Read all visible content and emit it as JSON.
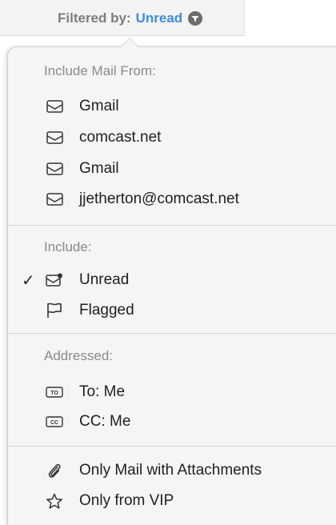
{
  "toolbar": {
    "filter_label": "Filtered by:",
    "filter_value": "Unread",
    "filter_icon": "filter-circle-icon"
  },
  "menu": {
    "mail_from": {
      "header": "Include Mail From:",
      "items": [
        {
          "label": "Gmail",
          "icon": "envelope-open-icon"
        },
        {
          "label": "comcast.net",
          "icon": "envelope-open-icon"
        },
        {
          "label": "Gmail",
          "icon": "envelope-open-icon"
        },
        {
          "label": "jjetherton@comcast.net",
          "icon": "envelope-open-icon"
        }
      ]
    },
    "include": {
      "header": "Include:",
      "items": [
        {
          "label": "Unread",
          "icon": "unread-envelope-icon",
          "checked": true
        },
        {
          "label": "Flagged",
          "icon": "flag-icon",
          "checked": false
        }
      ],
      "check_mark": "✓"
    },
    "addressed": {
      "header": "Addressed:",
      "items": [
        {
          "label": "To: Me",
          "icon": "to-badge-icon",
          "badge": "TO"
        },
        {
          "label": "CC: Me",
          "icon": "cc-badge-icon",
          "badge": "CC"
        }
      ]
    },
    "other": {
      "items": [
        {
          "label": "Only Mail with Attachments",
          "icon": "paperclip-icon"
        },
        {
          "label": "Only from VIP",
          "icon": "star-icon"
        }
      ]
    }
  }
}
